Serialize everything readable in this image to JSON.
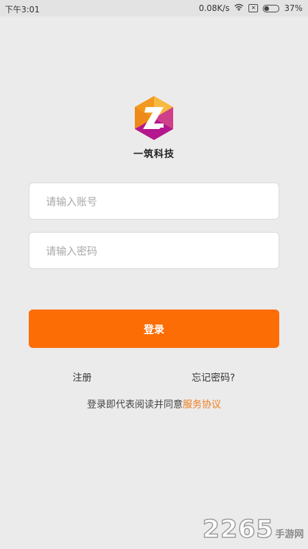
{
  "status_bar": {
    "time": "下午3:01",
    "net_speed": "0.08K/s",
    "sim_icon": "sim-disabled-icon",
    "wifi_icon": "wifi-icon",
    "battery_percent": 37,
    "battery_text": "37%"
  },
  "brand": {
    "name": "一筑科技",
    "logo_letter": "Z",
    "colors": {
      "orange": "#f5a623",
      "magenta": "#b5178f"
    }
  },
  "form": {
    "account_placeholder": "请输入账号",
    "password_placeholder": "请输入密码",
    "login_label": "登录",
    "login_color": "#fd6d05"
  },
  "links": {
    "register": "注册",
    "forgot_password": "忘记密码?"
  },
  "agreement": {
    "prefix": "登录即代表阅读并同意",
    "terms_link": "服务协议"
  },
  "watermark": {
    "number": "2265",
    "text": "手游网"
  }
}
